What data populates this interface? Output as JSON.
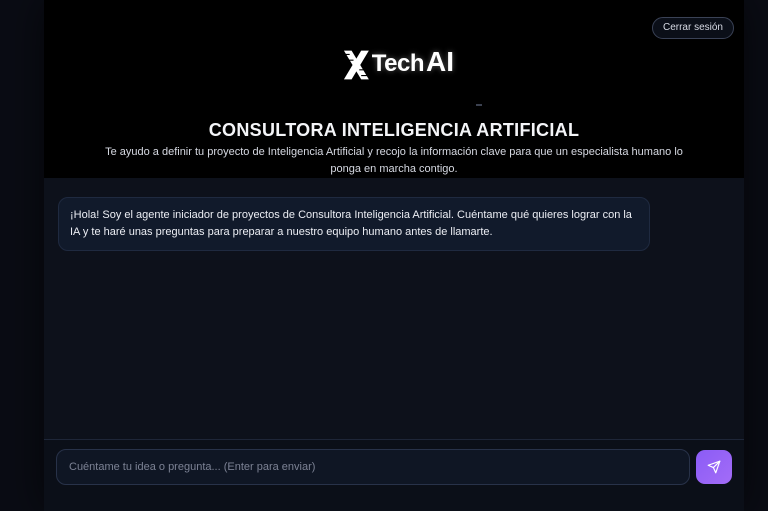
{
  "header": {
    "logout_label": "Cerrar sesión",
    "logo_text": "Tech",
    "logo_ai": "AI",
    "title": "CONSULTORA INTELIGENCIA ARTIFICIAL",
    "subtitle": "Te ayudo a definir tu proyecto de Inteligencia Artificial y recojo la información clave para que un especialista humano lo ponga en marcha contigo."
  },
  "chat": {
    "messages": [
      {
        "role": "assistant",
        "text": "¡Hola! Soy el agente iniciador de proyectos de Consultora Inteligencia Artificial. Cuéntame qué quieres lograr con la IA y te haré unas preguntas para preparar a nuestro equipo humano antes de llamarte."
      }
    ]
  },
  "composer": {
    "placeholder": "Cuéntame tu idea o pregunta... (Enter para enviar)",
    "send_icon": "paper-plane-icon"
  },
  "colors": {
    "accent": "#8b5cf6",
    "background": "#0d111b",
    "hero_background": "#000000"
  }
}
